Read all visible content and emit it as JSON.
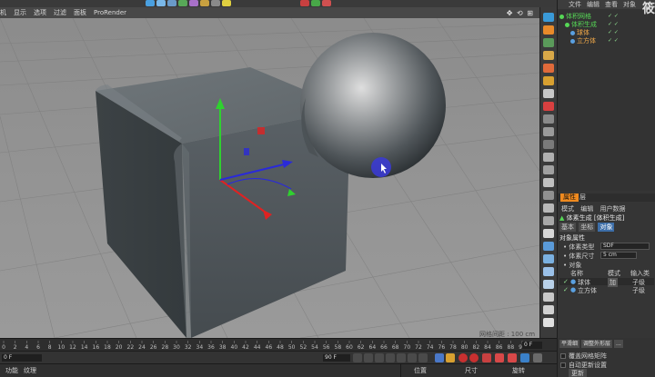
{
  "viewport": {
    "menu": [
      "机",
      "显示",
      "选项",
      "过滤",
      "面板",
      "ProRender"
    ],
    "nav_icons": "✥ ⟲ ⊞",
    "grid_spacing": "网格间距 : 100 cm"
  },
  "object_manager": {
    "menu": [
      "文件",
      "编辑",
      "查看",
      "对象"
    ],
    "brand": "筱",
    "items": [
      {
        "label": "体积网格",
        "color": "#56d856"
      },
      {
        "label": "体积生成",
        "color": "#56d856"
      },
      {
        "label": "球体",
        "color": "#f0a848"
      },
      {
        "label": "立方体",
        "color": "#f0a848"
      }
    ],
    "flags": "✓ ✓"
  },
  "attributes": {
    "title_tab": "属性",
    "second_tab": "层",
    "menu": [
      "模式",
      "编辑",
      "用户数据"
    ],
    "object_heading": "体素生成 [体积生成]",
    "tabs": [
      "基本",
      "坐标",
      "对象"
    ],
    "section": "对象属性",
    "voxel_type_label": "体素类型",
    "voxel_type_value": "SDF",
    "voxel_size_label": "体素尺寸",
    "voxel_size_value": "5 cm",
    "objects_label": "对象",
    "table_headers": [
      "名称",
      "模式",
      "输入类型"
    ],
    "rows": [
      {
        "name": "球体",
        "mode": "加",
        "type": "子级"
      },
      {
        "name": "立方体",
        "mode": "",
        "type": "子级"
      }
    ]
  },
  "timeline": {
    "ticks": [
      "0",
      "2",
      "4",
      "6",
      "8",
      "10",
      "12",
      "14",
      "16",
      "18",
      "20",
      "22",
      "24",
      "26",
      "28",
      "30",
      "32",
      "34",
      "36",
      "38",
      "40",
      "42",
      "44",
      "46",
      "48",
      "50",
      "52",
      "54",
      "56",
      "58",
      "60",
      "62",
      "64",
      "66",
      "68",
      "70",
      "72",
      "74",
      "76",
      "78",
      "80",
      "82",
      "84",
      "86",
      "88",
      "90"
    ],
    "end_field": "0 F"
  },
  "transport": {
    "start_frame": "0 F",
    "end_frame": "90 F"
  },
  "bottom_menu": [
    "功能",
    "纹理"
  ],
  "coordinates": {
    "headers": [
      "位置",
      "尺寸",
      "旋转"
    ]
  },
  "bottom_right": {
    "tabs": [
      "平滑细",
      "调整外形层",
      "..."
    ],
    "row1": "覆盖网格矩阵",
    "row2": "自动更新设置",
    "button": "更新"
  },
  "colors": {
    "accent_orange": "#f08a1f",
    "axis_y": "#2fd12f",
    "axis_x": "#e02222",
    "axis_z": "#2a2ad8"
  }
}
